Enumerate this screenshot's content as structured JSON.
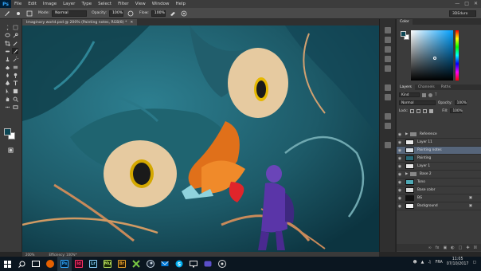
{
  "app": {
    "logo": "Ps"
  },
  "menu": [
    "File",
    "Edit",
    "Image",
    "Layer",
    "Type",
    "Select",
    "Filter",
    "View",
    "Window",
    "Help"
  ],
  "options": {
    "mode_label": "Mode:",
    "mode_value": "Normal",
    "opacity_label": "Opacity:",
    "opacity_value": "100%",
    "flow_label": "Flow:",
    "flow_value": "100%",
    "workspace": "3DEduro"
  },
  "document": {
    "tab_title": "Imaginary world.psd @ 200% (Painting notes, RGB/8) *",
    "zoom": "200%",
    "efficiency": "Efficiency: 100%*"
  },
  "color_panel": {
    "title": "Color",
    "fg": "#0c4654",
    "bg": "#ffffff"
  },
  "layers_panel": {
    "tabs": [
      "Layers",
      "Channels",
      "Paths"
    ],
    "kind": "Kind",
    "blend": "Normal",
    "opacity_label": "Opacity:",
    "opacity": "100%",
    "lock_label": "Lock:",
    "fill_label": "Fill:",
    "fill": "100%",
    "layers": [
      {
        "name": "Reference",
        "group": true,
        "thumb": "#555555",
        "selected": false,
        "locked": false
      },
      {
        "name": "Layer 11",
        "group": false,
        "thumb": "#e8e8e8",
        "selected": false,
        "locked": false
      },
      {
        "name": "Painting notes",
        "group": false,
        "thumb": "#d8dde4",
        "selected": true,
        "locked": false
      },
      {
        "name": "Painting",
        "group": false,
        "thumb": "#2a6a78",
        "selected": false,
        "locked": false
      },
      {
        "name": "Layer 1",
        "group": false,
        "thumb": "#e5e5e5",
        "selected": false,
        "locked": false
      },
      {
        "name": "Base 2",
        "group": true,
        "thumb": "#555555",
        "selected": false,
        "locked": false
      },
      {
        "name": "Tono",
        "group": false,
        "thumb": "#4fa9b5",
        "selected": false,
        "locked": false
      },
      {
        "name": "Base color",
        "group": false,
        "thumb": "#d9d9d9",
        "selected": false,
        "locked": false
      },
      {
        "name": "BG",
        "group": false,
        "thumb": "#111111",
        "selected": false,
        "locked": true
      },
      {
        "name": "Background",
        "group": false,
        "thumb": "#f2f2f2",
        "selected": false,
        "locked": true
      }
    ]
  },
  "taskbar": {
    "apps": [
      {
        "icon": "firefox-icon",
        "label": "",
        "color": "#e66000"
      },
      {
        "icon": "photoshop-icon",
        "label": "Ps",
        "color": "#31a8ff"
      },
      {
        "icon": "indesign-icon",
        "label": "Id",
        "color": "#ff3366"
      },
      {
        "icon": "lightroom-icon",
        "label": "Lr",
        "color": "#8ed4ff"
      },
      {
        "icon": "muse-icon",
        "label": "Mu",
        "color": "#b7de5a"
      },
      {
        "icon": "bridge-icon",
        "label": "Br",
        "color": "#e8a32c"
      }
    ],
    "lang": "FRA",
    "time": "11:05",
    "date": "07/10/2017"
  }
}
